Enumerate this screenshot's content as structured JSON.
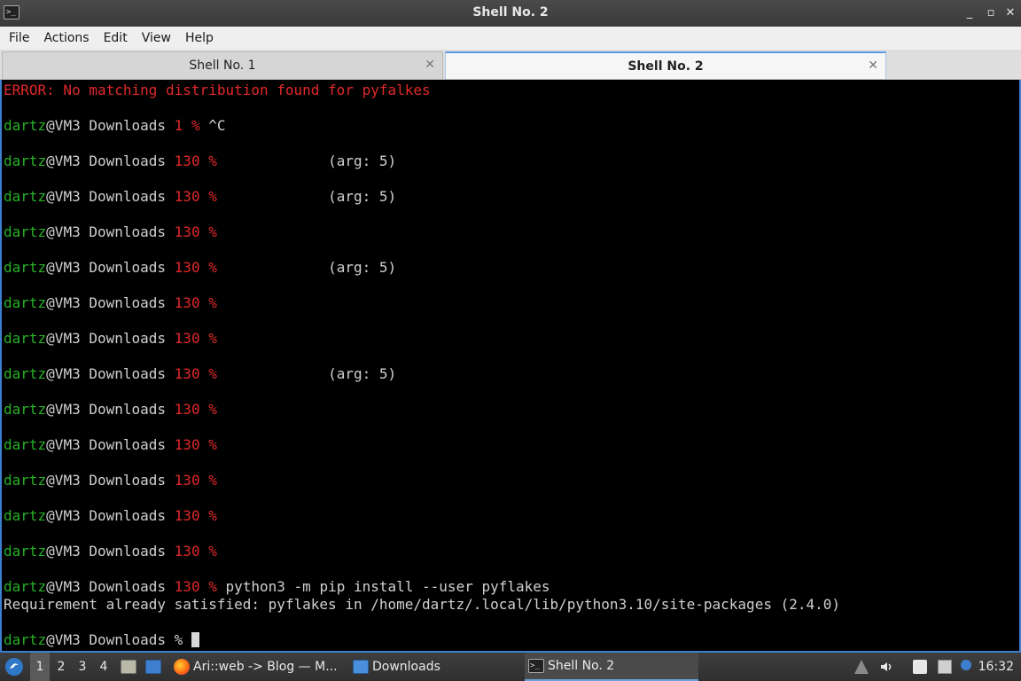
{
  "window": {
    "title": "Shell No. 2",
    "icon_glyph": ">_",
    "controls": [
      "_",
      "▫",
      "✕"
    ]
  },
  "menu": [
    "File",
    "Actions",
    "Edit",
    "View",
    "Help"
  ],
  "tabs": [
    {
      "label": "Shell No. 1",
      "close": "✕"
    },
    {
      "label": "Shell No. 2",
      "close": "✕"
    }
  ],
  "terminal": {
    "error_line": "ERROR: No matching distribution found for pyfalkes",
    "user": "dartz",
    "host_dir": "@VM3 Downloads ",
    "lines": [
      {
        "code": "1 %",
        "rest": " ^C"
      },
      {
        "code": "130 %",
        "rest": "             (arg: 5)"
      },
      {
        "code": "130 %",
        "rest": "             (arg: 5)"
      },
      {
        "code": "130 %",
        "rest": ""
      },
      {
        "code": "130 %",
        "rest": "             (arg: 5)"
      },
      {
        "code": "130 %",
        "rest": ""
      },
      {
        "code": "130 %",
        "rest": ""
      },
      {
        "code": "130 %",
        "rest": "             (arg: 5)"
      },
      {
        "code": "130 %",
        "rest": ""
      },
      {
        "code": "130 %",
        "rest": ""
      },
      {
        "code": "130 %",
        "rest": ""
      },
      {
        "code": "130 %",
        "rest": ""
      },
      {
        "code": "130 %",
        "rest": ""
      }
    ],
    "cmd_code": "130 %",
    "cmd": " python3 -m pip install --user pyflakes",
    "output": "Requirement already satisfied: pyflakes in /home/dartz/.local/lib/python3.10/site-packages (2.4.0)",
    "final_prompt_suffix": "%"
  },
  "taskbar": {
    "workspaces": [
      "1",
      "2",
      "3",
      "4"
    ],
    "windows": [
      {
        "label": "Ari::web -> Blog — M...",
        "icon": "firefox-icon"
      },
      {
        "label": "Downloads",
        "icon": "folder-icon"
      },
      {
        "label": "Shell No. 2",
        "icon": "terminal-icon"
      }
    ],
    "clock": "16:32"
  },
  "colors": {
    "accent": "#3d7ecf",
    "prompt_user": "#28b028",
    "error": "#e0282a"
  }
}
